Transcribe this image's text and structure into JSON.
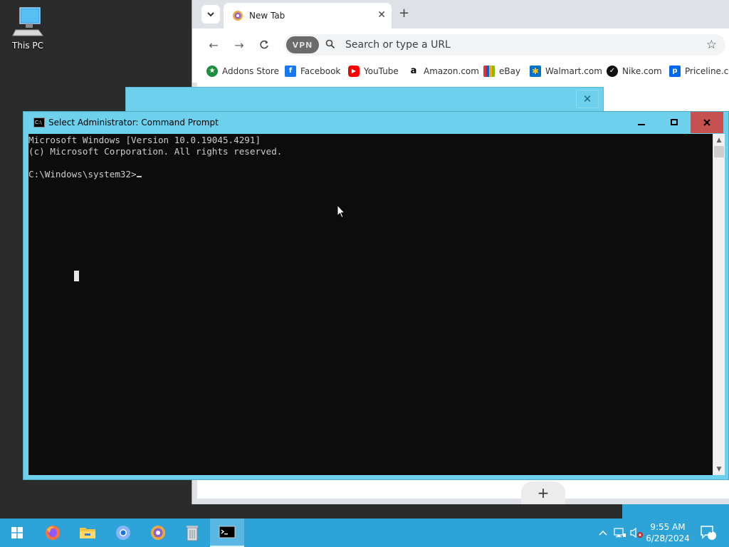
{
  "desktop": {
    "this_pc_label": "This PC"
  },
  "browser": {
    "tab_title": "New Tab",
    "vpn_label": "VPN",
    "omnibox_placeholder": "Search or type a URL",
    "bookmarks": [
      {
        "label": "Addons Store",
        "color": "#1e8e3e"
      },
      {
        "label": "Facebook",
        "color": "#1877f2"
      },
      {
        "label": "YouTube",
        "color": "#ff0000"
      },
      {
        "label": "Amazon.com",
        "color": "#ffffff"
      },
      {
        "label": "eBay",
        "color": "#333333"
      },
      {
        "label": "Walmart.com",
        "color": "#0071ce"
      },
      {
        "label": "Nike.com",
        "color": "#111111"
      },
      {
        "label": "Priceline.com",
        "color": "#0068ef"
      }
    ]
  },
  "cmd": {
    "title": "Select Administrator: Command Prompt",
    "lines": [
      "Microsoft Windows [Version 10.0.19045.4291]",
      "(c) Microsoft Corporation. All rights reserved.",
      "",
      "C:\\Windows\\system32>"
    ]
  },
  "taskbar": {
    "clock_time": "9:55 AM",
    "clock_date": "6/28/2024",
    "notification_count": "4"
  },
  "colors": {
    "taskbar": "#2ea3d7",
    "window_frame": "#6dd0ec",
    "close_button": "#c75050",
    "console_bg": "#0c0c0c"
  }
}
